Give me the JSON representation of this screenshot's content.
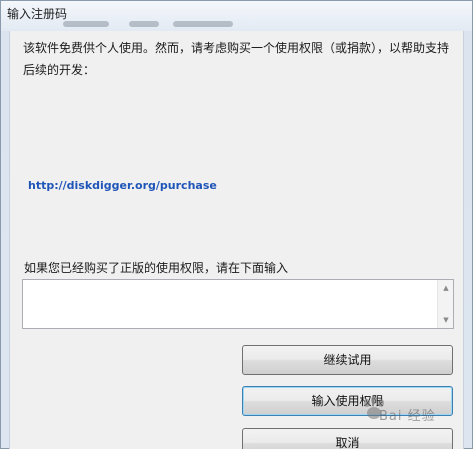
{
  "window": {
    "title": "输入注册码"
  },
  "dialog": {
    "intro_text": "该软件免费供个人使用。然而，请考虑购买一个使用权限（或捐款），以帮助支持后续的开发：",
    "purchase_link": "http://diskdigger.org/purchase",
    "prompt_label": "如果您已经购买了正版的使用权限，请在下面输入",
    "license_input": {
      "value": "",
      "placeholder": ""
    }
  },
  "buttons": {
    "continue_trial": "继续试用",
    "enter_license": "输入使用权限",
    "cancel": "取消"
  },
  "watermark": {
    "text": "Bai 经验"
  },
  "colors": {
    "link": "#1f55b8",
    "default_button_border": "#3c7fb1"
  }
}
